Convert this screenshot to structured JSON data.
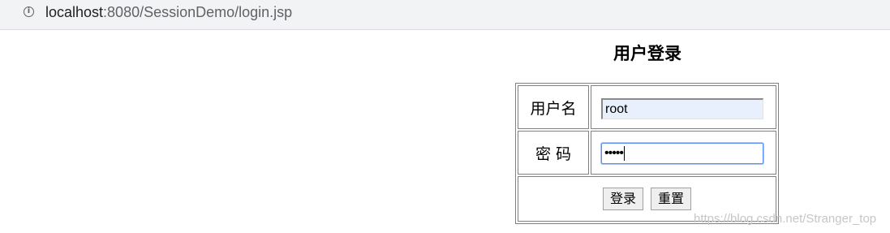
{
  "browser": {
    "url_host": "localhost",
    "url_rest": ":8080/SessionDemo/login.jsp",
    "info_icon": "info-icon"
  },
  "page": {
    "title": "用户登录"
  },
  "form": {
    "username_label": "用户名",
    "username_value": "root",
    "password_label": "密 码",
    "password_value": "•••••",
    "login_button": "登录",
    "reset_button": "重置"
  },
  "watermark": "https://blog.csdn.net/Stranger_top"
}
